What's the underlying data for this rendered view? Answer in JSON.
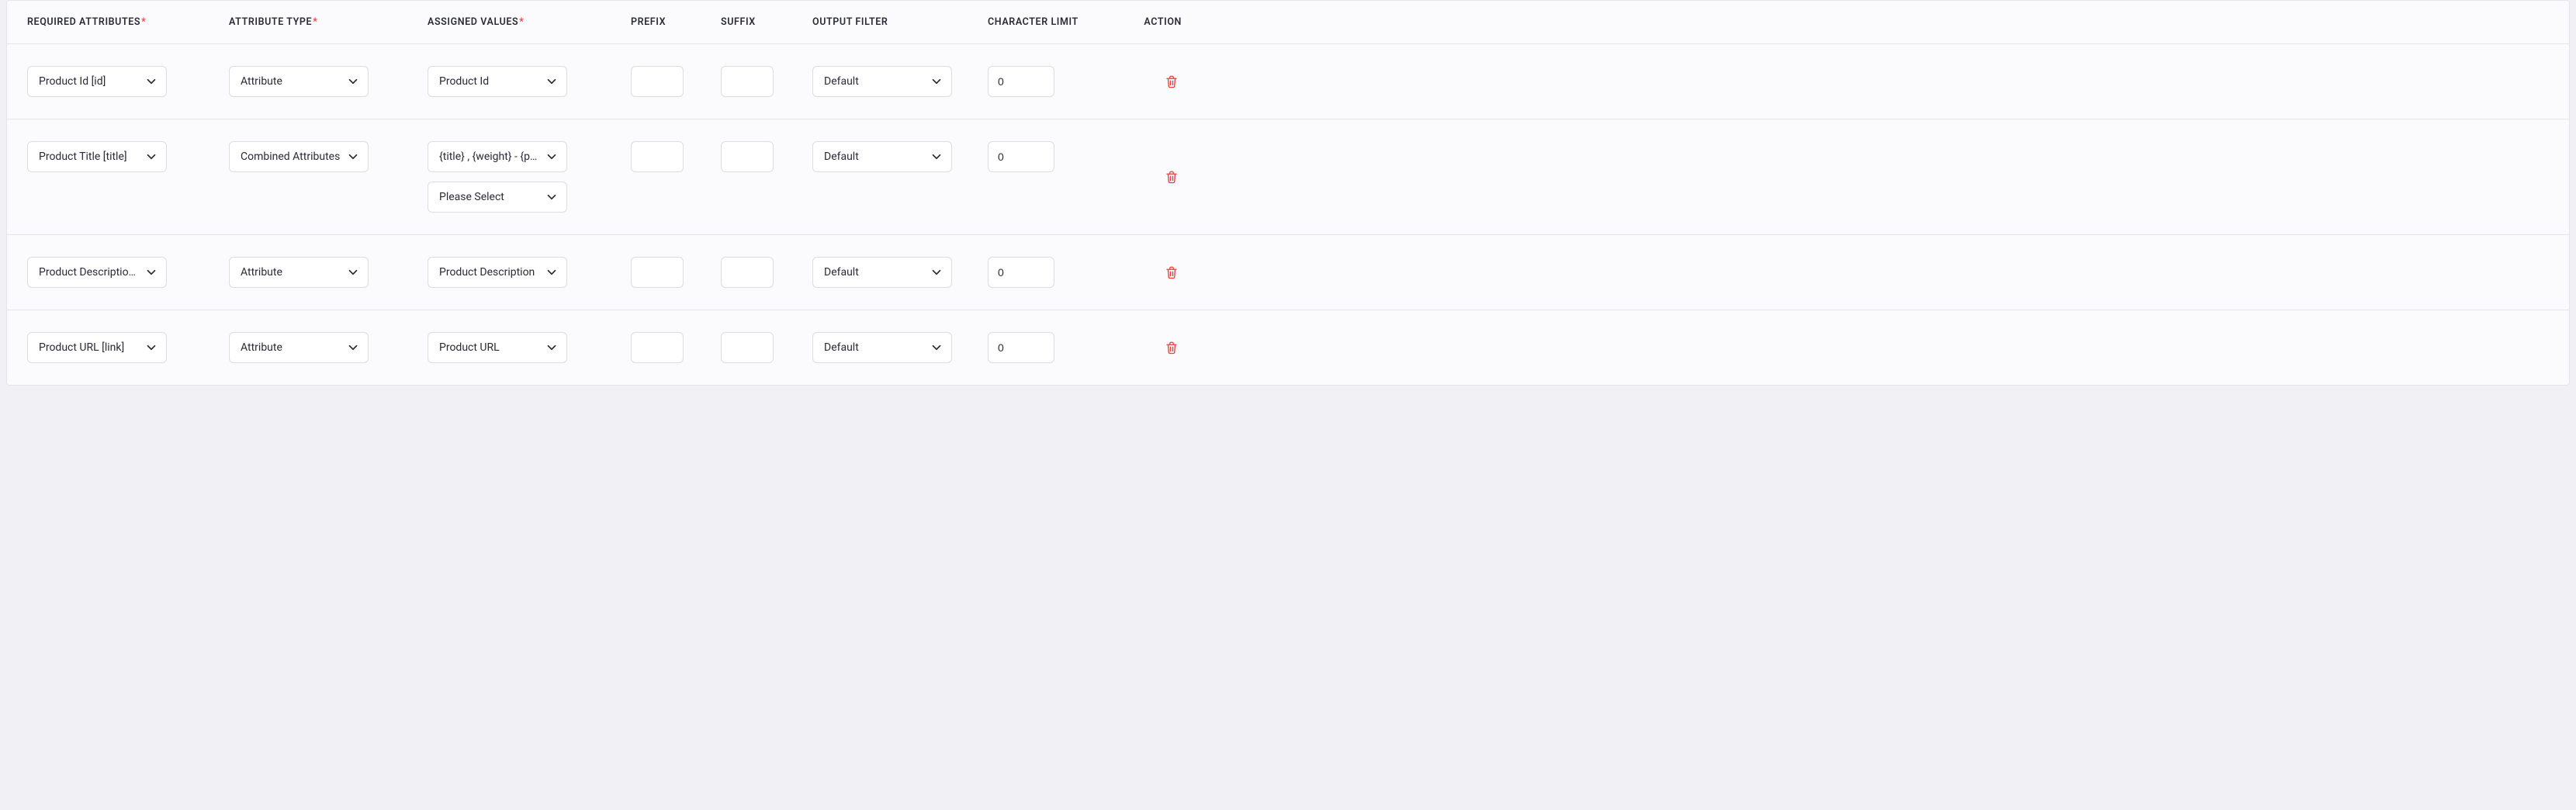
{
  "columns": {
    "required_attributes": "REQUIRED ATTRIBUTES",
    "attribute_type": "ATTRIBUTE TYPE",
    "assigned_values": "ASSIGNED VALUES",
    "prefix": "PREFIX",
    "suffix": "SUFFIX",
    "output_filter": "OUTPUT FILTER",
    "character_limit": "CHARACTER LIMIT",
    "action": "ACTION"
  },
  "required_marker": "*",
  "rows": [
    {
      "required_attribute": "Product Id [id]",
      "attribute_type": "Attribute",
      "assigned_values": [
        "Product Id"
      ],
      "prefix": "",
      "suffix": "",
      "output_filter": "Default",
      "character_limit": "0"
    },
    {
      "required_attribute": "Product Title [title]",
      "attribute_type": "Combined Attributes",
      "assigned_values": [
        "{title} , {weight} - {price}",
        "Please Select"
      ],
      "prefix": "",
      "suffix": "",
      "output_filter": "Default",
      "character_limit": "0"
    },
    {
      "required_attribute": "Product Description [description]",
      "attribute_type": "Attribute",
      "assigned_values": [
        "Product Description"
      ],
      "prefix": "",
      "suffix": "",
      "output_filter": "Default",
      "character_limit": "0"
    },
    {
      "required_attribute": "Product URL [link]",
      "attribute_type": "Attribute",
      "assigned_values": [
        "Product URL"
      ],
      "prefix": "",
      "suffix": "",
      "output_filter": "Default",
      "character_limit": "0"
    }
  ]
}
